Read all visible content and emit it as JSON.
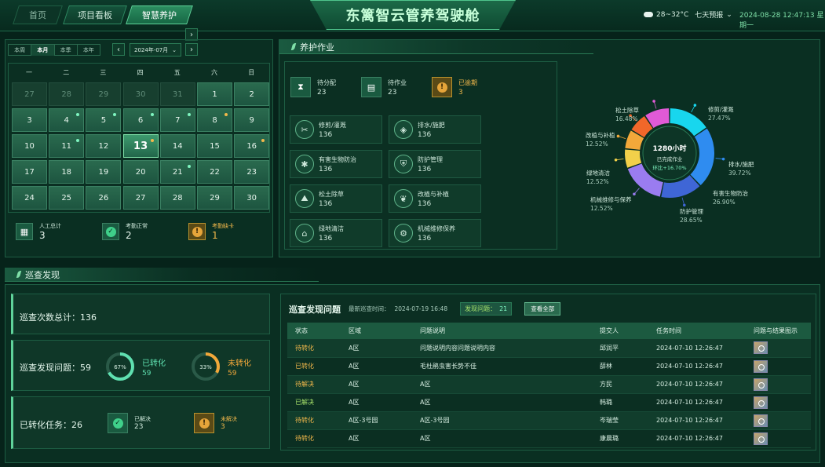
{
  "header": {
    "tabs": [
      {
        "label": "首页"
      },
      {
        "label": "项目看板"
      },
      {
        "label": "智慧养护"
      }
    ],
    "title": "东篱智云管养驾驶舱",
    "weather": {
      "temp": "28~32°C",
      "forecast": "七天预报"
    },
    "datetime": "2024-08-28 12:47:13 星期一"
  },
  "calendar": {
    "ranges": [
      "本周",
      "本月",
      "本季",
      "本年"
    ],
    "active_range": "本月",
    "month": "2024年-07月",
    "weekdays": [
      "一",
      "二",
      "三",
      "四",
      "五",
      "六",
      "日"
    ],
    "days": [
      {
        "d": "27",
        "faded": true
      },
      {
        "d": "28",
        "faded": true
      },
      {
        "d": "29",
        "faded": true
      },
      {
        "d": "30",
        "faded": true
      },
      {
        "d": "31",
        "faded": true
      },
      {
        "d": "1"
      },
      {
        "d": "2"
      },
      {
        "d": "3"
      },
      {
        "d": "4",
        "dot": "g"
      },
      {
        "d": "5",
        "dot": "g"
      },
      {
        "d": "6",
        "dot": "g"
      },
      {
        "d": "7",
        "dot": "g"
      },
      {
        "d": "8",
        "dot": "y"
      },
      {
        "d": "9"
      },
      {
        "d": "10"
      },
      {
        "d": "11",
        "dot": "g"
      },
      {
        "d": "12"
      },
      {
        "d": "13",
        "today": true,
        "dot": "y"
      },
      {
        "d": "14"
      },
      {
        "d": "15"
      },
      {
        "d": "16",
        "dot": "y"
      },
      {
        "d": "17"
      },
      {
        "d": "18"
      },
      {
        "d": "19"
      },
      {
        "d": "20"
      },
      {
        "d": "21",
        "dot": "g"
      },
      {
        "d": "22"
      },
      {
        "d": "23"
      },
      {
        "d": "24"
      },
      {
        "d": "25"
      },
      {
        "d": "26"
      },
      {
        "d": "27"
      },
      {
        "d": "28"
      },
      {
        "d": "29"
      },
      {
        "d": "30"
      }
    ],
    "stats": [
      {
        "label": "人工总计",
        "value": "3",
        "icon": "calendar-icon"
      },
      {
        "label": "考勤正常",
        "value": "2",
        "icon": "check-icon"
      },
      {
        "label": "考勤缺卡",
        "value": "1",
        "icon": "alert-icon",
        "warn": true
      }
    ]
  },
  "maintenance": {
    "title": "养护作业",
    "top": [
      {
        "label": "待分配",
        "value": "23",
        "icon": "hourglass-icon"
      },
      {
        "label": "待作业",
        "value": "23",
        "icon": "clipboard-icon"
      },
      {
        "label": "已逾期",
        "value": "3",
        "icon": "alert-icon",
        "warn": true
      }
    ],
    "tasks": [
      {
        "label": "修剪/灌溉",
        "value": "136",
        "icon": "scissors-icon"
      },
      {
        "label": "排水/施肥",
        "value": "136",
        "icon": "drain-icon"
      },
      {
        "label": "有害生物防治",
        "value": "136",
        "icon": "bug-icon"
      },
      {
        "label": "防护管理",
        "value": "136",
        "icon": "shield-icon"
      },
      {
        "label": "松土除草",
        "value": "136",
        "icon": "soil-icon"
      },
      {
        "label": "改植与补植",
        "value": "136",
        "icon": "sprout-icon"
      },
      {
        "label": "绿地清洁",
        "value": "136",
        "icon": "broom-icon"
      },
      {
        "label": "机械维修保养",
        "value": "136",
        "icon": "wrench-icon"
      }
    ],
    "donut": {
      "center_value": "1280小时",
      "center_label": "已完成作业",
      "center_change": "环比+16.70%",
      "slices": [
        {
          "name": "修剪/灌溉",
          "pct": "27.47%",
          "color": "#18d6ee"
        },
        {
          "name": "排水/施肥",
          "pct": "39.72%",
          "color": "#2f8cf0"
        },
        {
          "name": "有害生物防治",
          "pct": "26.90%",
          "color": "#3f66d6"
        },
        {
          "name": "防护管理",
          "pct": "28.65%",
          "color": "#9a7cf0"
        },
        {
          "name": "机械维修与保养",
          "pct": "12.52%",
          "color": "#f2d04a"
        },
        {
          "name": "绿地清洁",
          "pct": "12.52%",
          "color": "#f2a83a"
        },
        {
          "name": "改植与补植",
          "pct": "12.52%",
          "color": "#f2672a"
        },
        {
          "name": "松土除草",
          "pct": "16.48%",
          "color": "#e05ad6"
        }
      ]
    }
  },
  "inspection": {
    "title": "巡查发现",
    "total_label": "巡查次数总计：",
    "total_value": "136",
    "issues_label": "巡查发现问题：",
    "issues_value": "59",
    "converted": {
      "label": "已转化",
      "value": "59",
      "pct": "67%",
      "color": "#5fe0b0"
    },
    "unconverted": {
      "label": "未转化",
      "value": "59",
      "pct": "33%",
      "color": "#f2a83a"
    },
    "tasks_label": "已转化任务：",
    "tasks_value": "26",
    "resolved": {
      "label": "已解决",
      "value": "23"
    },
    "unresolved": {
      "label": "未解决",
      "value": "3"
    }
  },
  "issues_table": {
    "title": "巡查发现问题",
    "latest_label": "最新巡查时间：",
    "latest_time": "2024-07-19 16:48",
    "found_label": "发现问题：",
    "found_count": "21",
    "view_all": "查看全部",
    "columns": [
      "状态",
      "区域",
      "问题说明",
      "提交人",
      "任务时间",
      "问题与结果图示"
    ],
    "rows": [
      {
        "status": "待转化",
        "status_type": "warn",
        "area": "A区",
        "desc": "问题说明内容问题说明内容",
        "user": "邱润平",
        "time": "2024-07-10 12:26:47"
      },
      {
        "status": "已转化",
        "status_type": "warn",
        "area": "A区",
        "desc": "毛杜鹃虫害长势不佳",
        "user": "薛林",
        "time": "2024-07-10 12:26:47"
      },
      {
        "status": "待解决",
        "status_type": "warn",
        "area": "A区",
        "desc": "A区",
        "user": "方民",
        "time": "2024-07-10 12:26:47"
      },
      {
        "status": "已解决",
        "status_type": "ok",
        "area": "A区",
        "desc": "A区",
        "user": "韩璐",
        "time": "2024-07-10 12:26:47"
      },
      {
        "status": "待转化",
        "status_type": "warn",
        "area": "A区-3号园",
        "desc": "A区-3号园",
        "user": "岑瑞莹",
        "time": "2024-07-10 12:26:47"
      },
      {
        "status": "待转化",
        "status_type": "warn",
        "area": "A区",
        "desc": "A区",
        "user": "康晨璐",
        "time": "2024-07-10 12:26:47"
      }
    ]
  }
}
